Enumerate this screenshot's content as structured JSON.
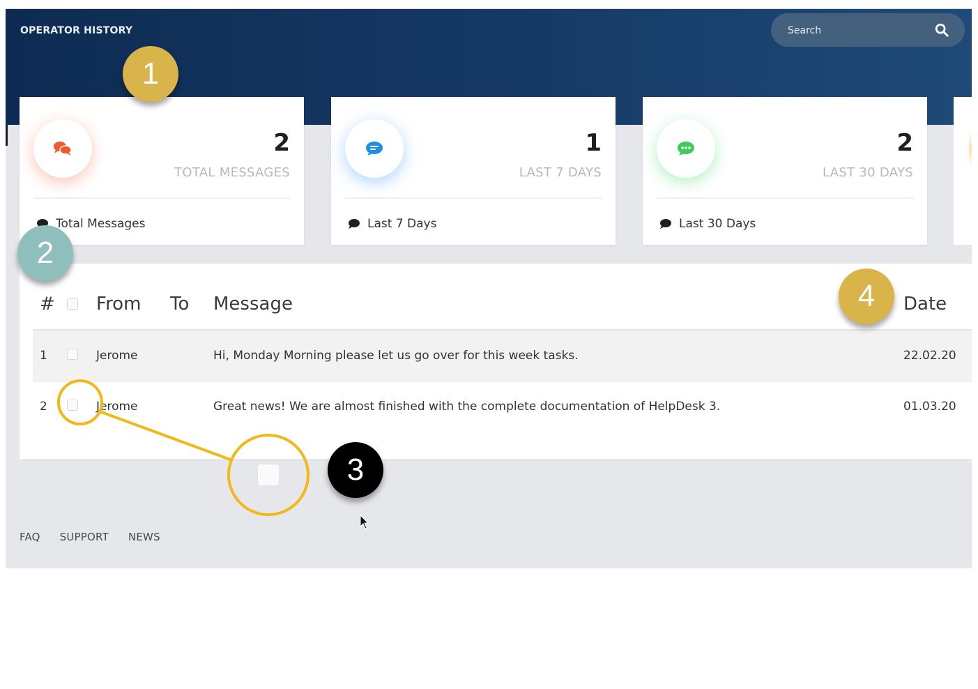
{
  "header": {
    "title": "OPERATOR HISTORY",
    "search_placeholder": "Search"
  },
  "stats": [
    {
      "value": "2",
      "caption": "TOTAL MESSAGES",
      "footer": "Total Messages",
      "color": "#f2592b",
      "glow": "#ffb8a3"
    },
    {
      "value": "1",
      "caption": "LAST 7 DAYS",
      "footer": "Last 7 Days",
      "color": "#1a8fe8",
      "glow": "#a7d3ff"
    },
    {
      "value": "2",
      "caption": "LAST 30 DAYS",
      "footer": "Last 30 Days",
      "color": "#3ecb5c",
      "glow": "#b5f0bf"
    }
  ],
  "table": {
    "columns": {
      "num": "#",
      "from": "From",
      "to": "To",
      "message": "Message",
      "date": "Date"
    },
    "rows": [
      {
        "num": "1",
        "from": "Jerome",
        "to": "",
        "message": "Hi, Monday Morning please let us go over for this week tasks.",
        "date": "22.02.20"
      },
      {
        "num": "2",
        "from": "Jerome",
        "to": "",
        "message": "Great news! We are almost finished with the complete documentation of HelpDesk 3.",
        "date": "01.03.20"
      }
    ]
  },
  "footer_links": [
    "FAQ",
    "SUPPORT",
    "NEWS"
  ],
  "annotations": [
    {
      "label": "1",
      "color": "#d9b44a"
    },
    {
      "label": "2",
      "color": "#8fbfbd"
    },
    {
      "label": "3",
      "color": "#000000"
    },
    {
      "label": "4",
      "color": "#d9b44a"
    }
  ],
  "callout_color": "#f2b81a"
}
